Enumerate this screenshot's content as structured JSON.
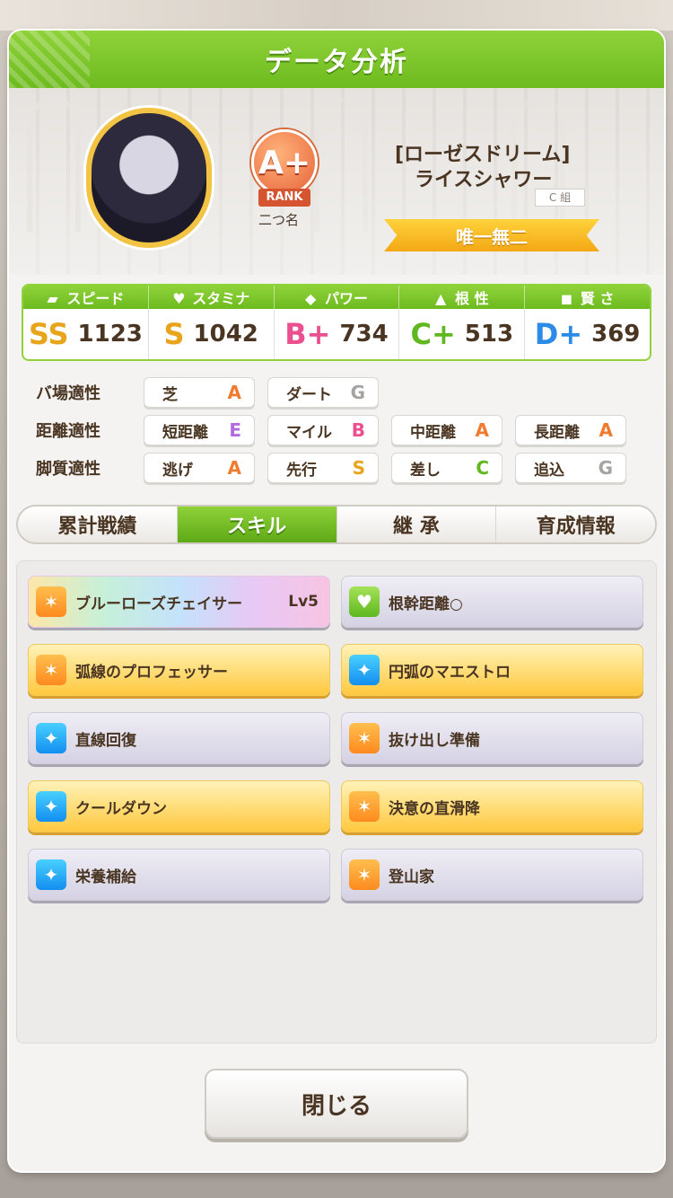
{
  "header": {
    "title": "データ分析"
  },
  "profile": {
    "rank": {
      "grade": "A+",
      "word": "RANK"
    },
    "nickname": "二つ名",
    "epithet": "[ローゼスドリーム]",
    "name": "ライスシャワー",
    "class_tag": "C 組",
    "title_banner": "唯一無二"
  },
  "stats": [
    {
      "label": "スピード",
      "grade": "SS",
      "value": "1123",
      "icon": "shoe-icon"
    },
    {
      "label": "スタミナ",
      "grade": "S",
      "value": "1042",
      "icon": "heart-icon"
    },
    {
      "label": "パワー",
      "grade": "B+",
      "value": "734",
      "icon": "arm-icon"
    },
    {
      "label": "根 性",
      "grade": "C+",
      "value": "513",
      "icon": "flame-icon"
    },
    {
      "label": "賢 さ",
      "grade": "D+",
      "value": "369",
      "icon": "cap-icon"
    }
  ],
  "grade_colors": {
    "SS": "#e8a41b",
    "S": "#e8a41b",
    "A": "#f07a2e",
    "B": "#ea4f8f",
    "B+": "#ea4f8f",
    "C": "#5fb81f",
    "C+": "#5fb81f",
    "D+": "#2c8be6",
    "E": "#b36be0",
    "G": "#a5a3a1"
  },
  "aptitudes": [
    {
      "label": "バ場適性",
      "items": [
        {
          "name": "芝",
          "grade": "A"
        },
        {
          "name": "ダート",
          "grade": "G"
        }
      ]
    },
    {
      "label": "距離適性",
      "items": [
        {
          "name": "短距離",
          "grade": "E"
        },
        {
          "name": "マイル",
          "grade": "B"
        },
        {
          "name": "中距離",
          "grade": "A"
        },
        {
          "name": "長距離",
          "grade": "A"
        }
      ]
    },
    {
      "label": "脚質適性",
      "items": [
        {
          "name": "逃げ",
          "grade": "A"
        },
        {
          "name": "先行",
          "grade": "S"
        },
        {
          "name": "差し",
          "grade": "C"
        },
        {
          "name": "追込",
          "grade": "G"
        }
      ]
    }
  ],
  "tabs": [
    {
      "label": "累計戦績",
      "active": false
    },
    {
      "label": "スキル",
      "active": true
    },
    {
      "label": "継 承",
      "active": false
    },
    {
      "label": "育成情報",
      "active": false
    }
  ],
  "skills": [
    {
      "name": "ブルーローズチェイサー",
      "level": "Lv5",
      "style": "rainbow",
      "icon": "orange"
    },
    {
      "name": "根幹距離○",
      "level": "",
      "style": "normal",
      "icon": "green"
    },
    {
      "name": "弧線のプロフェッサー",
      "level": "",
      "style": "gold",
      "icon": "orange"
    },
    {
      "name": "円弧のマエストロ",
      "level": "",
      "style": "gold",
      "icon": "blue"
    },
    {
      "name": "直線回復",
      "level": "",
      "style": "normal",
      "icon": "blue"
    },
    {
      "name": "抜け出し準備",
      "level": "",
      "style": "normal",
      "icon": "orange"
    },
    {
      "name": "クールダウン",
      "level": "",
      "style": "gold",
      "icon": "blue"
    },
    {
      "name": "決意の直滑降",
      "level": "",
      "style": "gold",
      "icon": "orange"
    },
    {
      "name": "栄養補給",
      "level": "",
      "style": "normal",
      "icon": "blue"
    },
    {
      "name": "登山家",
      "level": "",
      "style": "normal",
      "icon": "orange"
    }
  ],
  "close_button": {
    "label": "閉じる"
  }
}
